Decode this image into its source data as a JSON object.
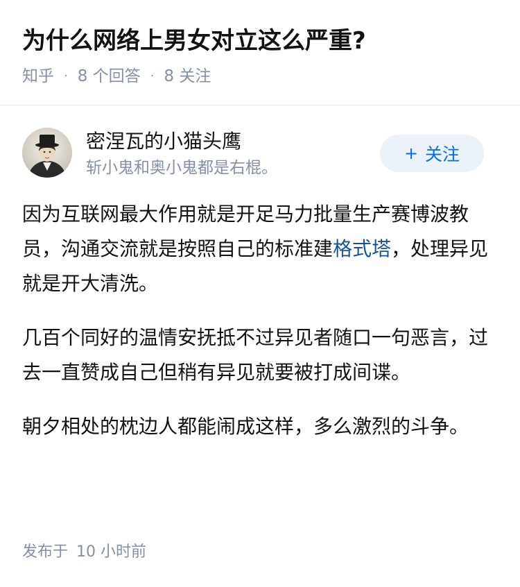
{
  "question": {
    "title": "为什么网络上男女对立这么严重?",
    "source": "知乎",
    "answers": "8 个回答",
    "follows": "8 关注"
  },
  "author": {
    "name": "密涅瓦的小猫头鹰",
    "bio": "斩小鬼和奥小鬼都是右棍。",
    "follow_label": "关注",
    "avatar_icon": "portrait-avatar-icon"
  },
  "answer": {
    "p1_a": "因为互联网最大作用就是开足马力批量生产赛博波教员，沟通交流就是按照自己的标准建",
    "p1_link": "格式塔",
    "p1_b": "，处理异见就是开大清洗。",
    "p2": "几百个同好的温情安抚抵不过异见者随口一句恶言，过去一直赞成自己但稍有异见就要被打成间谍。",
    "p3": "朝夕相处的枕边人都能闹成这样，多么激烈的斗争。"
  },
  "footer": {
    "label": "发布于",
    "time": "10 小时前"
  },
  "colors": {
    "accent": "#056de8",
    "link": "#175199",
    "meta": "#8590a6",
    "follow_bg": "#ebf2fa"
  }
}
